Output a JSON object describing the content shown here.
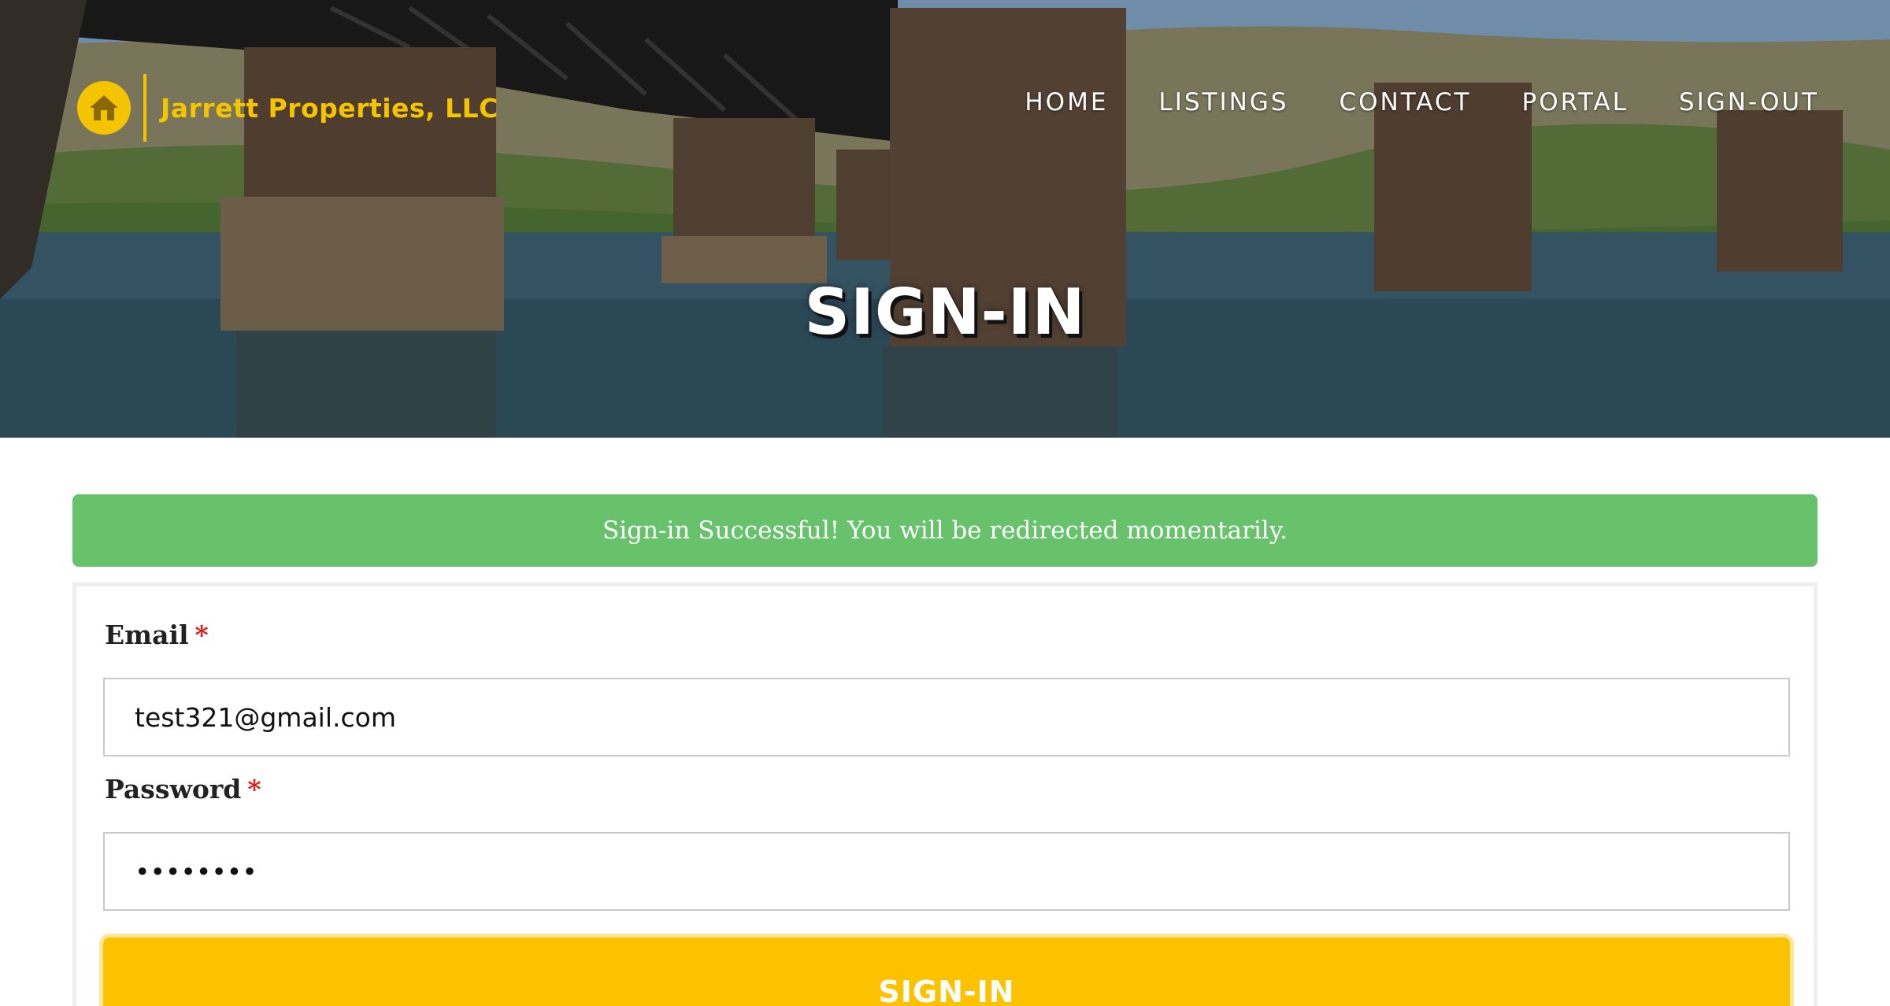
{
  "brand": {
    "name": "Jarrett Properties, LLC",
    "icon": "house-icon",
    "color": "#f5c400"
  },
  "nav": {
    "items": [
      {
        "label": "HOME"
      },
      {
        "label": "LISTINGS"
      },
      {
        "label": "CONTACT"
      },
      {
        "label": "PORTAL"
      },
      {
        "label": "SIGN-OUT"
      }
    ]
  },
  "hero": {
    "title": "SIGN-IN"
  },
  "alert": {
    "message": "Sign-in Successful! You will be redirected momentarily.",
    "color": "#67c26b"
  },
  "form": {
    "email": {
      "label": "Email",
      "required_mark": "*",
      "value": "test321@gmail.com"
    },
    "password": {
      "label": "Password",
      "required_mark": "*",
      "value": "••••••••"
    },
    "submit_label": "SIGN-IN",
    "submit_color": "#fcc200"
  }
}
